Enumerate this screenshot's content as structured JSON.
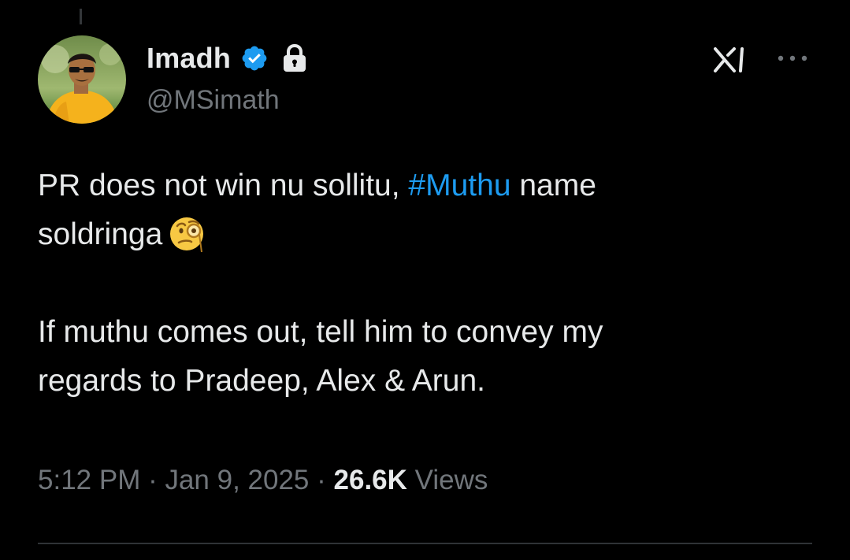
{
  "author": {
    "display_name": "Imadh",
    "handle": "@MSimath",
    "verified": true,
    "protected": true
  },
  "tweet": {
    "line1_before": "PR does not win nu sollitu, ",
    "hashtag": "#Muthu",
    "line1_after": " name",
    "line2": "soldringa",
    "emoji": "face-with-monocle",
    "para2_line1": "If muthu comes out, tell him to convey my",
    "para2_line2": "regards to Pradeep, Alex & Arun."
  },
  "meta": {
    "time": "5:12 PM",
    "separator": " · ",
    "date": "Jan 9, 2025",
    "views_count": "26.6K",
    "views_label": "Views"
  },
  "icons": {
    "verified": "verified-badge-icon",
    "lock": "lock-icon",
    "grok": "grok-icon",
    "more": "more-options-icon"
  },
  "colors": {
    "background": "#000000",
    "text": "#e7e9ea",
    "secondary": "#71767b",
    "accent": "#1d9bf0"
  }
}
